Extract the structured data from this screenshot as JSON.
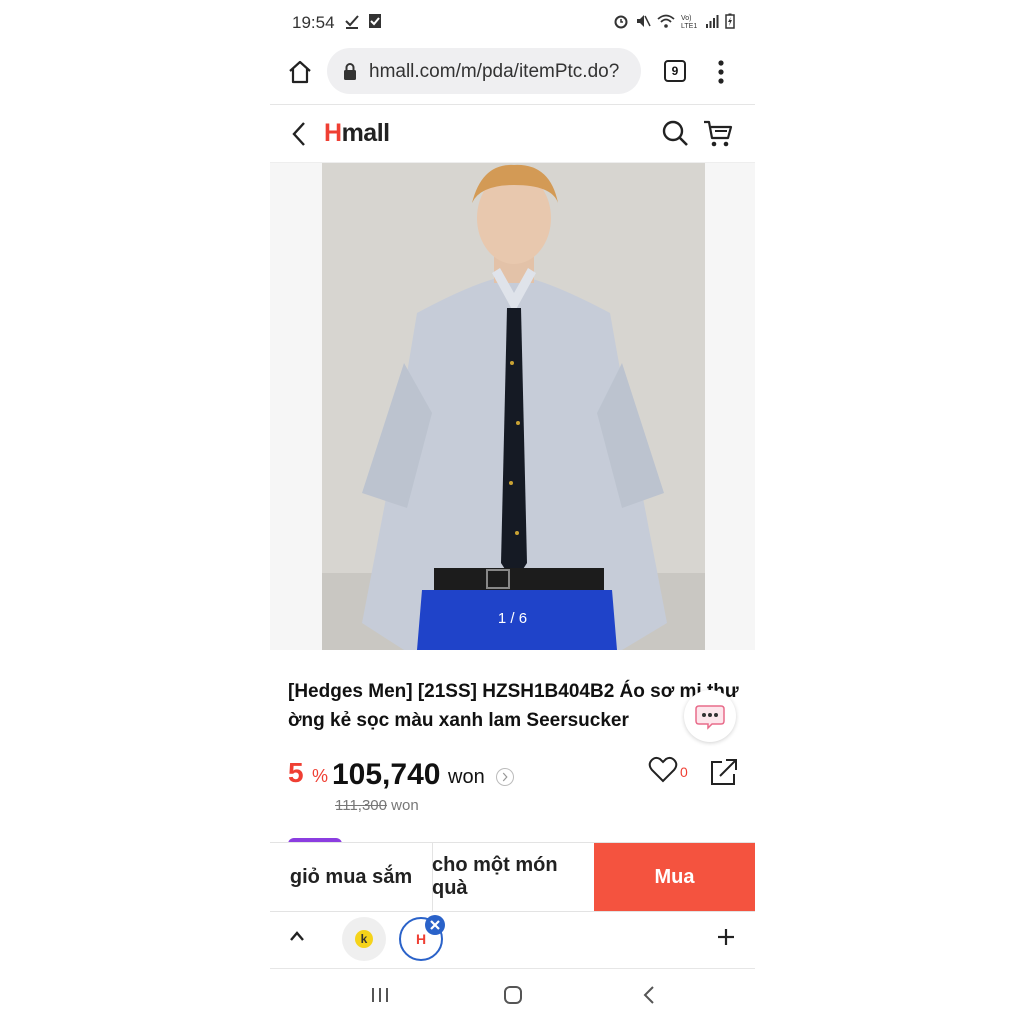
{
  "status": {
    "time": "19:54"
  },
  "browser": {
    "url": "hmall.com/m/pda/itemPtc.do?",
    "tab_count": "9"
  },
  "app": {
    "logo_prefix": "H",
    "logo_rest": "mall"
  },
  "gallery": {
    "counter": "1 / 6"
  },
  "product": {
    "title": "[Hedges Men] [21SS] HZSH1B404B2 Áo sơ mi thư ờng kẻ sọc màu xanh lam Seersucker",
    "discount": "5",
    "discount_unit": "%",
    "price": "105,740",
    "price_unit": "won",
    "original_price": "111,300",
    "original_unit": "won",
    "likes": "0"
  },
  "actions": {
    "cart": "giỏ mua sắm",
    "gift": "cho một món quà",
    "buy": "Mua"
  },
  "tabs": {
    "k_label": "k",
    "h_label": "H"
  },
  "colors": {
    "brand_red": "#ef3f33",
    "buy_button": "#f4533f",
    "accent_blue": "#2a62c9"
  }
}
